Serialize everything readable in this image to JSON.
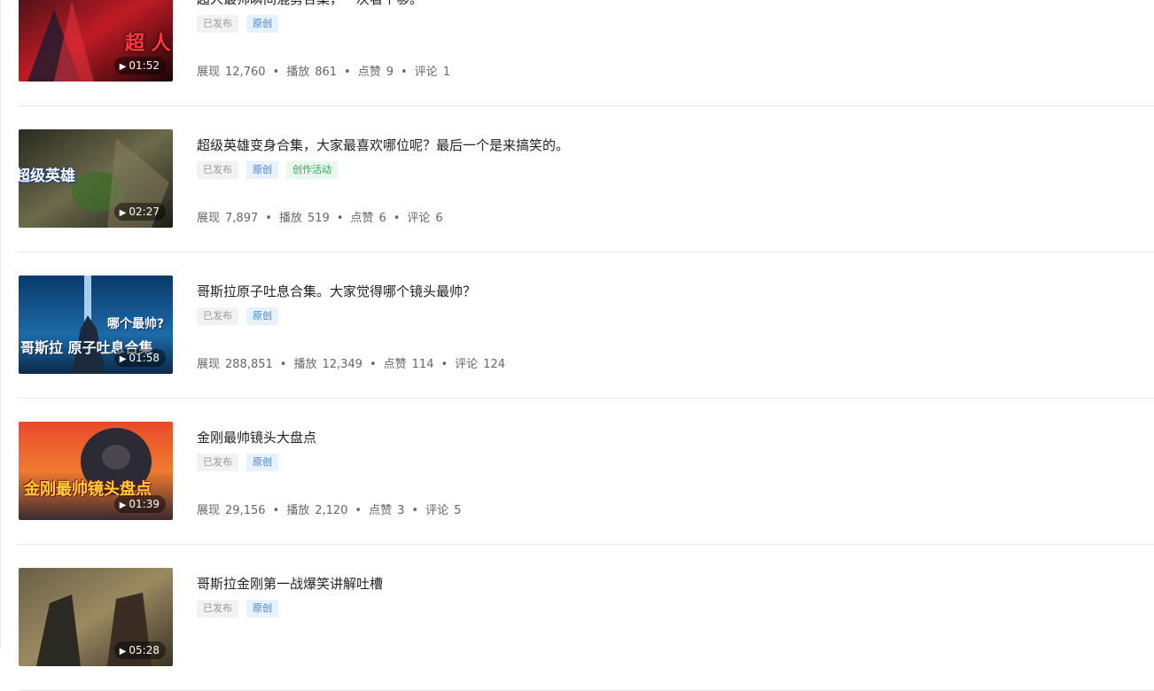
{
  "stat_labels": {
    "impressions": "展现",
    "plays": "播放",
    "likes": "点赞",
    "comments": "评论"
  },
  "videos": [
    {
      "title": "超人最帅瞬间混剪合集，一次看个够。",
      "duration": "01:52",
      "status_tag": "已发布",
      "original_tag": "原创",
      "extra_tag": "",
      "impressions": "12,760",
      "plays": "861",
      "likes": "9",
      "comments": "1",
      "thumbnail_text": "超 人"
    },
    {
      "title": "超级英雄变身合集，大家最喜欢哪位呢？最后一个是来搞笑的。",
      "duration": "02:27",
      "status_tag": "已发布",
      "original_tag": "原创",
      "extra_tag": "创作活动",
      "impressions": "7,897",
      "plays": "519",
      "likes": "6",
      "comments": "6",
      "thumbnail_text": "超级英雄"
    },
    {
      "title": "哥斯拉原子吐息合集。大家觉得哪个镜头最帅？",
      "duration": "01:58",
      "status_tag": "已发布",
      "original_tag": "原创",
      "extra_tag": "",
      "impressions": "288,851",
      "plays": "12,349",
      "likes": "114",
      "comments": "124",
      "thumbnail_text": "哥斯拉 原子吐息合集",
      "thumbnail_text_2": "哪个最帅?"
    },
    {
      "title": "金刚最帅镜头大盘点",
      "duration": "01:39",
      "status_tag": "已发布",
      "original_tag": "原创",
      "extra_tag": "",
      "impressions": "29,156",
      "plays": "2,120",
      "likes": "3",
      "comments": "5",
      "thumbnail_text": "金刚最帅镜头盘点"
    },
    {
      "title": "哥斯拉金刚第一战爆笑讲解吐槽",
      "duration": "05:28",
      "status_tag": "已发布",
      "original_tag": "原创",
      "extra_tag": ""
    }
  ],
  "colors": {
    "original_tag": "#3d7ed8",
    "activity_tag": "#2ba85a",
    "status_tag": "#999999",
    "divider": "#e8e8e8"
  },
  "icons": {
    "duration_play": "play-icon"
  }
}
